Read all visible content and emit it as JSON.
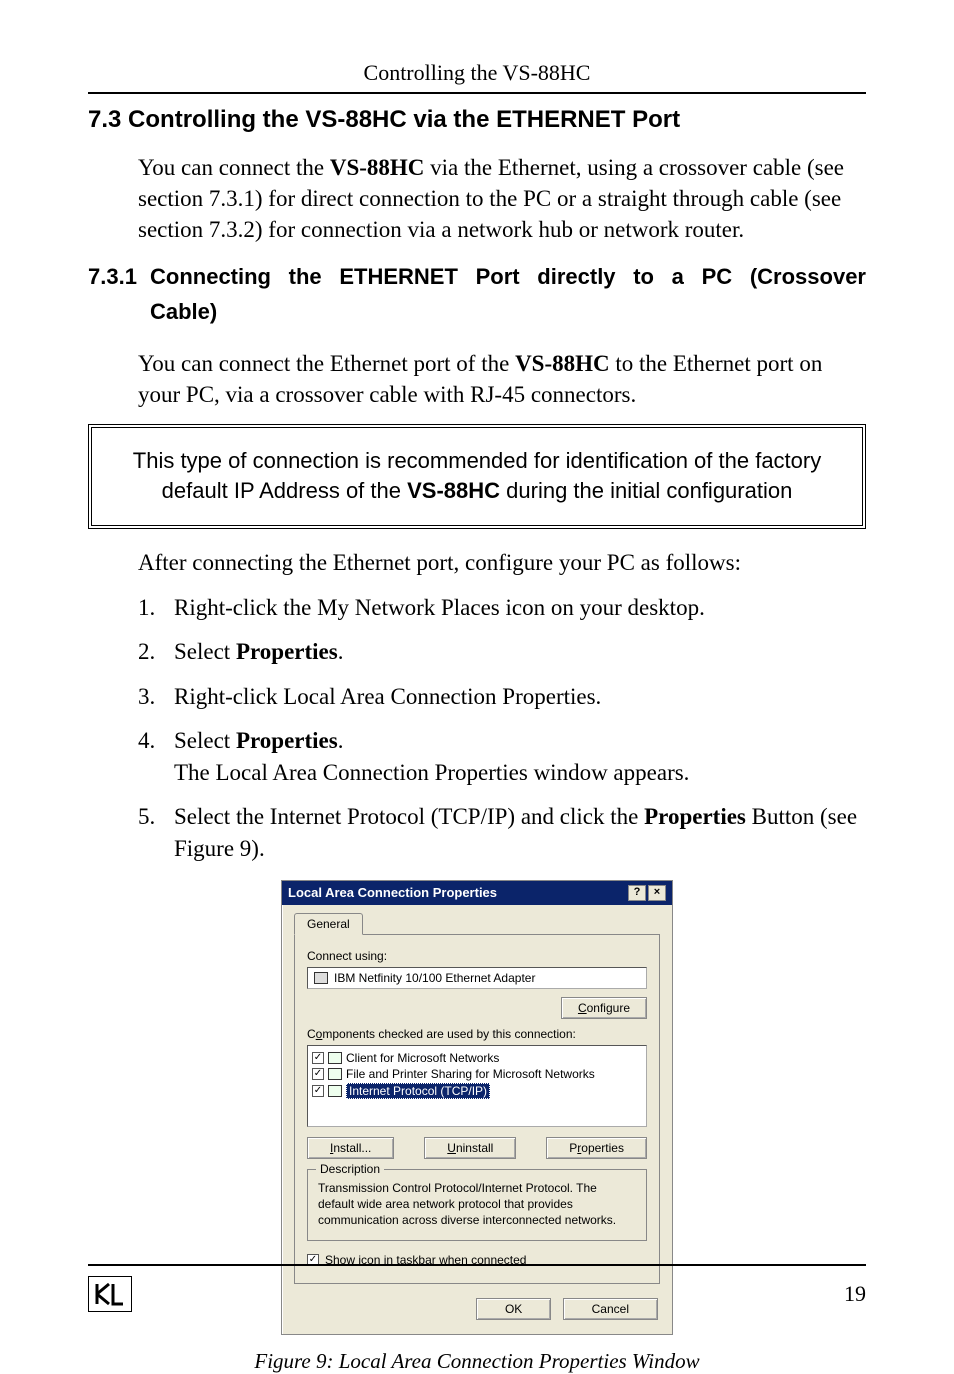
{
  "header": {
    "running": "Controlling the VS-88HC"
  },
  "h2": {
    "num": "7.3",
    "title": "Controlling the VS-88HC via the ETHERNET Port"
  },
  "para1_a": "You can connect the ",
  "para1_b": "VS-88HC",
  "para1_c": " via the Ethernet, using a crossover cable (see section 7.3.1) for direct connection to the PC or a straight through cable (see section 7.3.2) for connection via a network hub or network router.",
  "h3": {
    "num": "7.3.1",
    "title_line1": "Connecting the ETHERNET Port directly to a PC (Crossover",
    "title_line2": "Cable)"
  },
  "para2_a": "You can connect the Ethernet port of the ",
  "para2_b": "VS-88HC",
  "para2_c": " to the Ethernet port on your PC, via a crossover cable with RJ-45 connectors.",
  "callout_a": "This type of connection is recommended for identification of the factory default IP Address of the ",
  "callout_b": "VS-88HC",
  "callout_c": " during the initial configuration",
  "para3": "After connecting the Ethernet port, configure your PC as follows:",
  "steps": [
    {
      "n": "1.",
      "t": "Right-click the My Network Places icon on your desktop."
    },
    {
      "n": "2.",
      "t_a": "Select ",
      "t_b": "Properties",
      "t_c": "."
    },
    {
      "n": "3.",
      "t": "Right-click Local Area Connection Properties."
    },
    {
      "n": "4.",
      "t_a": "Select ",
      "t_b": "Properties",
      "t_c": ".",
      "t2": "The Local Area Connection Properties window appears."
    },
    {
      "n": "5.",
      "t_a": "Select the Internet Protocol (TCP/IP) and click the ",
      "t_b": "Properties",
      "t_c": " Button (see Figure 9)."
    }
  ],
  "dialog": {
    "title": "Local Area Connection Properties",
    "help": "?",
    "close": "×",
    "tab": "General",
    "connect_using": "Connect using:",
    "adapter": "IBM Netfinity 10/100 Ethernet Adapter",
    "configure": "Configure",
    "components_label": "Components checked are used by this connection:",
    "items": [
      "Client for Microsoft Networks",
      "File and Printer Sharing for Microsoft Networks",
      "Internet Protocol (TCP/IP)"
    ],
    "install": "Install...",
    "uninstall": "Uninstall",
    "properties": "Properties",
    "desc_label": "Description",
    "desc_text": "Transmission Control Protocol/Internet Protocol. The default wide area network protocol that provides communication across diverse interconnected networks.",
    "show_icon": "Show icon in taskbar when connected",
    "ok": "OK",
    "cancel": "Cancel"
  },
  "figure_caption": "Figure 9: Local Area Connection Properties Window",
  "page_number": "19"
}
